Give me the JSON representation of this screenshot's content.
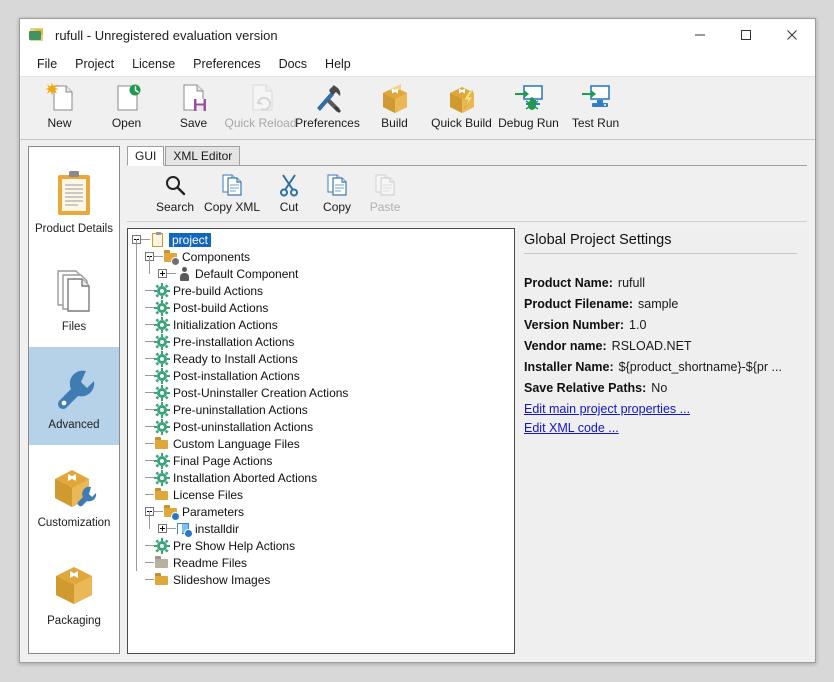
{
  "window": {
    "title": "rufull - Unregistered evaluation version",
    "app_icon": "app-logo-icon",
    "controls": {
      "minimize": "minimize-icon",
      "maximize": "maximize-icon",
      "close": "close-icon"
    }
  },
  "menubar": {
    "items": [
      {
        "label": "File"
      },
      {
        "label": "Project"
      },
      {
        "label": "License"
      },
      {
        "label": "Preferences"
      },
      {
        "label": "Docs"
      },
      {
        "label": "Help"
      }
    ]
  },
  "toolbar": {
    "buttons": [
      {
        "label": "New",
        "icon": "new-document-icon",
        "disabled": false
      },
      {
        "label": "Open",
        "icon": "open-document-icon",
        "disabled": false
      },
      {
        "label": "Save",
        "icon": "save-disk-icon",
        "disabled": false
      },
      {
        "label": "Quick Reload",
        "icon": "reload-icon",
        "disabled": true
      },
      {
        "label": "Preferences",
        "icon": "tools-icon",
        "disabled": false
      },
      {
        "label": "Build",
        "icon": "box-icon",
        "disabled": false
      },
      {
        "label": "Quick Build",
        "icon": "box-lightning-icon",
        "disabled": false
      },
      {
        "label": "Debug Run",
        "icon": "monitor-bug-icon",
        "disabled": false
      },
      {
        "label": "Test Run",
        "icon": "monitor-run-icon",
        "disabled": false
      }
    ]
  },
  "sidebar": {
    "items": [
      {
        "label": "Product Details",
        "icon": "clipboard-icon",
        "selected": false
      },
      {
        "label": "Files",
        "icon": "documents-icon",
        "selected": false
      },
      {
        "label": "Advanced",
        "icon": "wrench-icon",
        "selected": true
      },
      {
        "label": "Customization",
        "icon": "box-wrench-icon",
        "selected": false
      },
      {
        "label": "Packaging",
        "icon": "box-icon",
        "selected": false
      }
    ]
  },
  "tabs": [
    {
      "label": "GUI",
      "active": true
    },
    {
      "label": "XML Editor",
      "active": false
    }
  ],
  "inner_toolbar": {
    "buttons": [
      {
        "label": "Search",
        "icon": "magnifier-icon",
        "disabled": false
      },
      {
        "label": "Copy XML",
        "icon": "copy-xml-icon",
        "disabled": false
      },
      {
        "label": "Cut",
        "icon": "scissors-icon",
        "disabled": false
      },
      {
        "label": "Copy",
        "icon": "copy-icon",
        "disabled": false
      },
      {
        "label": "Paste",
        "icon": "paste-icon",
        "disabled": true
      }
    ]
  },
  "tree": {
    "nodes": [
      {
        "label": "project",
        "indent": 0,
        "icon": "clipboard-icon",
        "expander": "minus",
        "selected": true
      },
      {
        "label": "Components",
        "indent": 1,
        "icon": "folder-cog-icon",
        "expander": "minus",
        "selected": false
      },
      {
        "label": "Default Component",
        "indent": 2,
        "icon": "component-person-icon",
        "expander": "plus",
        "selected": false
      },
      {
        "label": "Pre-build Actions",
        "indent": 1,
        "icon": "gear-icon",
        "expander": "none",
        "selected": false
      },
      {
        "label": "Post-build Actions",
        "indent": 1,
        "icon": "gear-icon",
        "expander": "none",
        "selected": false
      },
      {
        "label": "Initialization Actions",
        "indent": 1,
        "icon": "gear-icon",
        "expander": "none",
        "selected": false
      },
      {
        "label": "Pre-installation Actions",
        "indent": 1,
        "icon": "gear-icon",
        "expander": "none",
        "selected": false
      },
      {
        "label": "Ready to Install Actions",
        "indent": 1,
        "icon": "gear-icon",
        "expander": "none",
        "selected": false
      },
      {
        "label": "Post-installation Actions",
        "indent": 1,
        "icon": "gear-icon",
        "expander": "none",
        "selected": false
      },
      {
        "label": "Post-Uninstaller Creation Actions",
        "indent": 1,
        "icon": "gear-icon",
        "expander": "none",
        "selected": false
      },
      {
        "label": "Pre-uninstallation Actions",
        "indent": 1,
        "icon": "gear-icon",
        "expander": "none",
        "selected": false
      },
      {
        "label": "Post-uninstallation Actions",
        "indent": 1,
        "icon": "gear-icon",
        "expander": "none",
        "selected": false
      },
      {
        "label": "Custom Language Files",
        "indent": 1,
        "icon": "folder-icon",
        "expander": "none",
        "selected": false
      },
      {
        "label": "Final Page Actions",
        "indent": 1,
        "icon": "gear-icon",
        "expander": "none",
        "selected": false
      },
      {
        "label": "Installation Aborted Actions",
        "indent": 1,
        "icon": "gear-icon",
        "expander": "none",
        "selected": false
      },
      {
        "label": "License Files",
        "indent": 1,
        "icon": "folder-icon",
        "expander": "none",
        "selected": false
      },
      {
        "label": "Parameters",
        "indent": 1,
        "icon": "folder-param-icon",
        "expander": "minus",
        "selected": false
      },
      {
        "label": "installdir",
        "indent": 2,
        "icon": "param-doc-icon",
        "expander": "plus",
        "selected": false
      },
      {
        "label": "Pre Show Help Actions",
        "indent": 1,
        "icon": "gear-icon",
        "expander": "none",
        "selected": false
      },
      {
        "label": "Readme Files",
        "indent": 1,
        "icon": "folder-gray-icon",
        "expander": "none",
        "selected": false
      },
      {
        "label": "Slideshow Images",
        "indent": 1,
        "icon": "folder-icon",
        "expander": "none",
        "selected": false
      }
    ]
  },
  "right_panel": {
    "title": "Global Project Settings",
    "fields": [
      {
        "key": "Product Name:",
        "value": "rufull"
      },
      {
        "key": "Product Filename:",
        "value": "sample"
      },
      {
        "key": "Version Number:",
        "value": "1.0"
      },
      {
        "key": "Vendor name:",
        "value": "RSLOAD.NET"
      },
      {
        "key": "Installer Name:",
        "value": "${product_shortname}-${pr ..."
      },
      {
        "key": "Save Relative Paths:",
        "value": "No"
      }
    ],
    "links": [
      {
        "label": "Edit main project properties ..."
      },
      {
        "label": "Edit XML code ..."
      }
    ]
  },
  "colors": {
    "selection_blue": "#1267bd",
    "sidebar_selected": "#b6d2e8",
    "link": "#1414c8",
    "folder_orange": "#e0a83c",
    "gear_green": "#3aa37a",
    "accent_blue": "#2f7fc1"
  }
}
